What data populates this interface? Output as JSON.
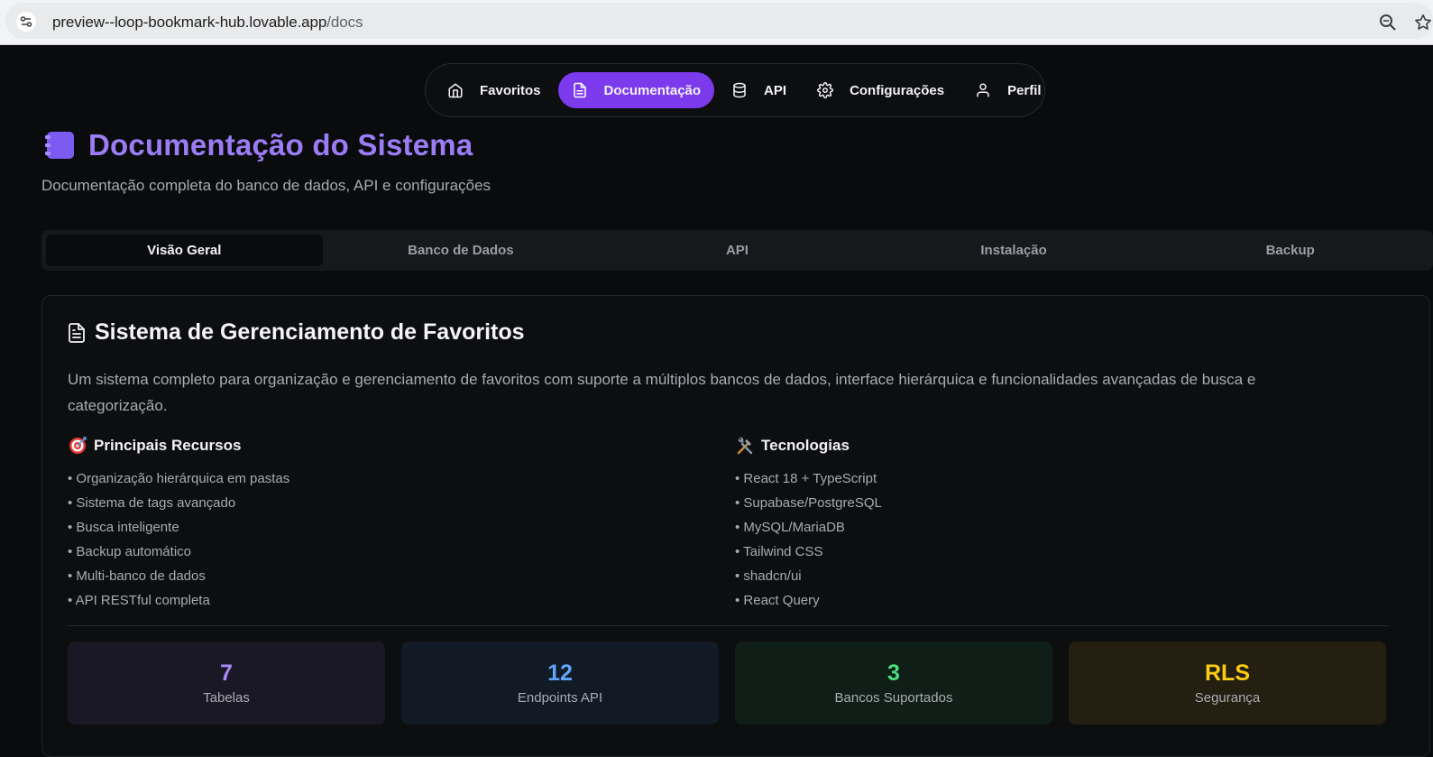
{
  "browser": {
    "url_host": "preview--loop-bookmark-hub.lovable.app",
    "url_path": "/docs"
  },
  "nav": {
    "items": [
      {
        "label": "Favoritos",
        "icon": "home-icon"
      },
      {
        "label": "Documentação",
        "icon": "file-text-icon",
        "active": true
      },
      {
        "label": "API",
        "icon": "database-icon"
      },
      {
        "label": "Configurações",
        "icon": "gear-icon"
      },
      {
        "label": "Perfil",
        "icon": "user-icon"
      }
    ]
  },
  "header": {
    "title": "Documentação do Sistema",
    "subtitle": "Documentação completa do banco de dados, API e configurações"
  },
  "tabs": [
    {
      "label": "Visão Geral",
      "active": true
    },
    {
      "label": "Banco de Dados"
    },
    {
      "label": "API"
    },
    {
      "label": "Instalação"
    },
    {
      "label": "Backup"
    }
  ],
  "card": {
    "title": "Sistema de Gerenciamento de Favoritos",
    "description": "Um sistema completo para organização e gerenciamento de favoritos com suporte a múltiplos bancos de dados, interface hierárquica e funcionalidades avançadas de busca e categorização.",
    "features": {
      "heading": "Principais Recursos",
      "items": [
        "• Organização hierárquica em pastas",
        "• Sistema de tags avançado",
        "• Busca inteligente",
        "• Backup automático",
        "• Multi-banco de dados",
        "• API RESTful completa"
      ]
    },
    "technologies": {
      "heading": "Tecnologias",
      "items": [
        "• React 18 + TypeScript",
        "• Supabase/PostgreSQL",
        "• MySQL/MariaDB",
        "• Tailwind CSS",
        "• shadcn/ui",
        "• React Query"
      ]
    },
    "stats": [
      {
        "value": "7",
        "label": "Tabelas",
        "color": "#a78bfa",
        "bg": "#1b1826"
      },
      {
        "value": "12",
        "label": "Endpoints API",
        "color": "#60a5fa",
        "bg": "#121a26"
      },
      {
        "value": "3",
        "label": "Bancos Suportados",
        "color": "#4ade80",
        "bg": "#0f1f17"
      },
      {
        "value": "RLS",
        "label": "Segurança",
        "color": "#facc15",
        "bg": "#241f10"
      }
    ]
  },
  "colors": {
    "accent": "#7c3aed",
    "title": "#9b7cf5",
    "background": "#0a0b0d"
  }
}
